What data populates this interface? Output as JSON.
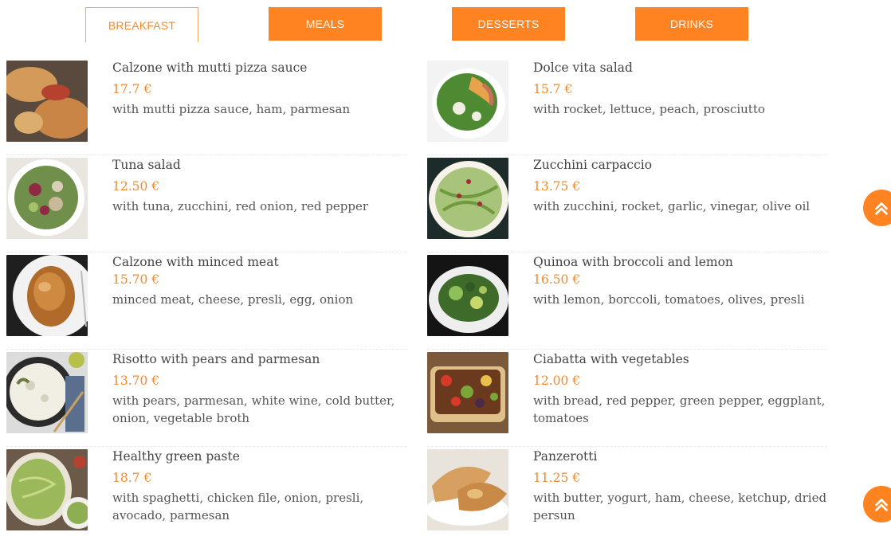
{
  "tabs": [
    {
      "label": "BREAKFAST",
      "active": true
    },
    {
      "label": "MEALS",
      "active": false
    },
    {
      "label": "DESSERTS",
      "active": false
    },
    {
      "label": "DRINKS",
      "active": false
    }
  ],
  "left_items": [
    {
      "title": "Calzone with mutti pizza sauce",
      "price": "17.7 €",
      "desc": "with mutti pizza sauce, ham, parmesan"
    },
    {
      "title": "Tuna salad",
      "price": "12.50 €",
      "desc": "with tuna, zucchini, red onion, red pepper"
    },
    {
      "title": "Calzone with minced meat",
      "price": "15.70 €",
      "desc": "minced meat, cheese, presli, egg, onion"
    },
    {
      "title": "Risotto with pears and parmesan",
      "price": "13.70 €",
      "desc": "with pears, parmesan, white wine, cold butter, onion, vegetable broth"
    },
    {
      "title": "Healthy green paste",
      "price": "18.7 €",
      "desc": "with spaghetti, chicken file, onion, presli, avocado, parmesan"
    }
  ],
  "right_items": [
    {
      "title": "Dolce vita salad",
      "price": "15.7 €",
      "desc": "with rocket, lettuce, peach, prosciutto"
    },
    {
      "title": "Zucchini carpaccio",
      "price": "13.75 €",
      "desc": "with zucchini, rocket, garlic, vinegar, olive oil"
    },
    {
      "title": "Quinoa with broccoli and lemon",
      "price": "16.50 €",
      "desc": "with lemon, borccoli, tomatoes, olives, presli"
    },
    {
      "title": "Ciabatta with vegetables",
      "price": "12.00 €",
      "desc": "with bread, red pepper, green pepper, eggplant, tomatoes"
    },
    {
      "title": "Panzerotti",
      "price": "11.25 €",
      "desc": "with butter, yogurt, ham, cheese, ketchup, dried persun"
    }
  ],
  "icons": {
    "scroll_top": "double-chevron-up-icon"
  },
  "colors": {
    "accent": "#ff8421",
    "price": "#f08a2e"
  }
}
